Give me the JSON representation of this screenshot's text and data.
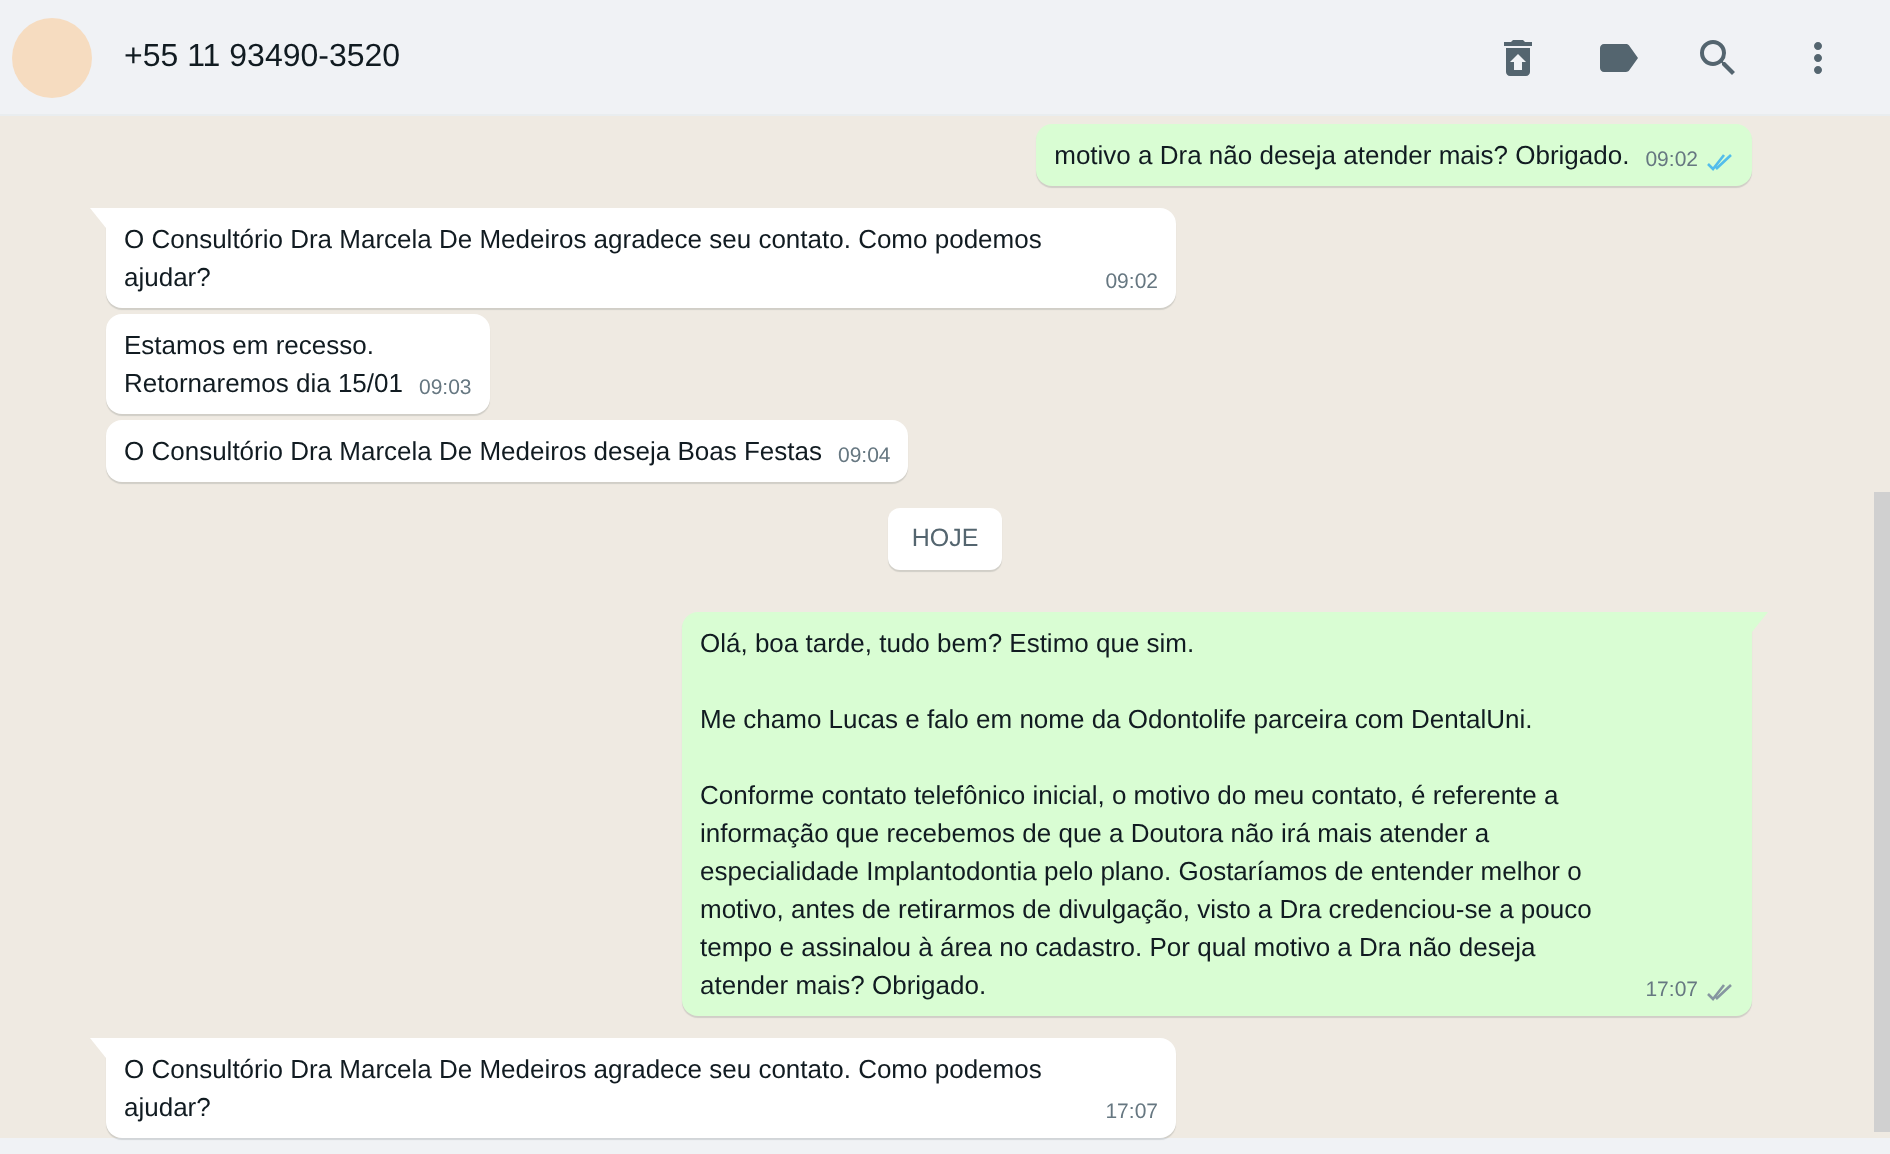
{
  "header": {
    "title": "+55 11 93490-3520"
  },
  "messages": [
    {
      "kind": "message",
      "outgoing": true,
      "tail": false,
      "text": "motivo a Dra não deseja atender mais? Obrigado.",
      "time": "09:02",
      "read": true
    },
    {
      "kind": "message",
      "outgoing": false,
      "tail": true,
      "text": "O Consultório Dra Marcela De Medeiros agradece seu contato. Como podemos ajudar?",
      "time": "09:02"
    },
    {
      "kind": "message",
      "outgoing": false,
      "tail": false,
      "text": "Estamos em recesso.\nRetornaremos dia 15/01",
      "time": "09:03"
    },
    {
      "kind": "message",
      "outgoing": false,
      "tail": false,
      "text": "O Consultório Dra Marcela De Medeiros deseja Boas Festas",
      "time": "09:04"
    },
    {
      "kind": "date",
      "text": "HOJE"
    },
    {
      "kind": "message",
      "outgoing": true,
      "tail": true,
      "text": "Olá, boa tarde, tudo bem? Estimo que sim.\n\nMe chamo Lucas e falo em nome da Odontolife parceira com DentalUni.\n\nConforme contato telefônico inicial, o motivo do meu contato, é referente a informação que recebemos de que a Doutora não irá mais atender a especialidade Implantodontia pelo plano. Gostaríamos de entender melhor o motivo, antes de retirarmos de divulgação, visto a Dra credenciou-se a pouco tempo e assinalou à área no cadastro. Por qual motivo a Dra não deseja atender mais? Obrigado.",
      "time": "17:07",
      "read": false
    },
    {
      "kind": "message",
      "outgoing": false,
      "tail": true,
      "text": "O Consultório Dra Marcela De Medeiros agradece seu contato. Como podemos ajudar?",
      "time": "17:07"
    }
  ]
}
